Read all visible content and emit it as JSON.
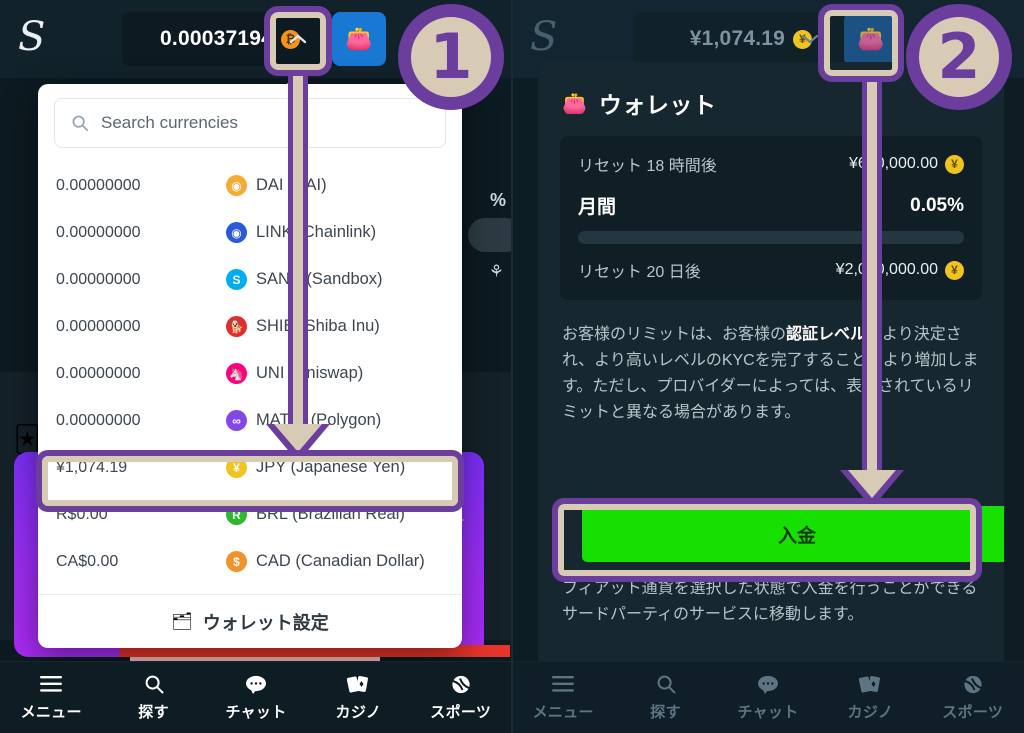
{
  "left": {
    "brand": "S",
    "topbar": {
      "balance_amount": "0.00037194",
      "balance_coin_symbol": "₿",
      "chevron_icon": "chevron-up-icon",
      "wallet_icon": "wallet-icon"
    },
    "background": {
      "percent_text": "%"
    },
    "dropdown": {
      "search_placeholder": "Search currencies",
      "currencies": [
        {
          "amount": "0.00000000",
          "code": "DAI",
          "name": "(DAI)",
          "icon_symbol": "◉",
          "icon_color": "#f5ac37"
        },
        {
          "amount": "0.00000000",
          "code": "LINK",
          "name": "(Chainlink)",
          "icon_symbol": "◉",
          "icon_color": "#2a5ada"
        },
        {
          "amount": "0.00000000",
          "code": "SAND",
          "name": "(Sandbox)",
          "icon_symbol": "S",
          "icon_color": "#00aeef"
        },
        {
          "amount": "0.00000000",
          "code": "SHIB",
          "name": "(Shiba Inu)",
          "icon_symbol": "🐕",
          "icon_color": "#e32c2c"
        },
        {
          "amount": "0.00000000",
          "code": "UNI",
          "name": "(Uniswap)",
          "icon_symbol": "🦄",
          "icon_color": "#ff007a"
        },
        {
          "amount": "0.00000000",
          "code": "MATIC",
          "name": "(Polygon)",
          "icon_symbol": "∞",
          "icon_color": "#8247e5"
        },
        {
          "amount": "¥1,074.19",
          "code": "JPY",
          "name": "(Japanese Yen)",
          "icon_symbol": "¥",
          "icon_color": "#f0c420",
          "selected": true
        },
        {
          "amount": "R$0.00",
          "code": "BRL",
          "name": "(Brazilian Real)",
          "icon_symbol": "R",
          "icon_color": "#2eb82e"
        },
        {
          "amount": "CA$0.00",
          "code": "CAD",
          "name": "(Canadian Dollar)",
          "icon_symbol": "$",
          "icon_color": "#f0932b"
        }
      ],
      "wallet_settings_label": "ウォレット設定",
      "wallet_settings_icon": "wallet-settings-icon"
    },
    "bottom_nav": [
      {
        "label": "メニュー",
        "icon": "menu-icon"
      },
      {
        "label": "探す",
        "icon": "search-icon"
      },
      {
        "label": "チャット",
        "icon": "chat-icon"
      },
      {
        "label": "カジノ",
        "icon": "casino-cards-icon"
      },
      {
        "label": "スポーツ",
        "icon": "sports-ball-icon"
      }
    ]
  },
  "right": {
    "brand": "S",
    "topbar": {
      "balance_amount": "¥1,074.19",
      "balance_coin_symbol": "¥",
      "chevron_icon": "chevron-down-icon",
      "wallet_icon": "wallet-icon"
    },
    "wallet_sheet": {
      "title": "ウォレット",
      "title_icon": "wallet-icon",
      "close_icon": "close-icon",
      "limits": {
        "reset_hours_label": "リセット 18 時間後",
        "reset_hours_value": "¥650,000.00",
        "reset_hours_coin": "¥",
        "monthly_label": "月間",
        "monthly_percent": "0.05%",
        "progress_percent": 0.05,
        "reset_days_label": "リセット 20 日後",
        "reset_days_value": "¥2,000,000.00",
        "reset_days_coin": "¥"
      },
      "note_pre": "お客様のリミットは、お客様の",
      "note_bold": "認証レベル",
      "note_post": "により決定され、より高いレベルのKYCを完了することにより増加します。ただし、プロバイダーによっては、表示されているリミットと異なる場合があります。",
      "deposit_button": "入金",
      "note2": "フィアット通貨を選択した状態で入金を行うことができるサードパーティのサービスに移動します。"
    },
    "bottom_nav": [
      {
        "label": "メニュー",
        "icon": "menu-icon"
      },
      {
        "label": "探す",
        "icon": "search-icon"
      },
      {
        "label": "チャット",
        "icon": "chat-icon"
      },
      {
        "label": "カジノ",
        "icon": "casino-cards-icon"
      },
      {
        "label": "スポーツ",
        "icon": "sports-ball-icon"
      }
    ]
  },
  "annotations": {
    "step1": "1",
    "step2": "2",
    "accent_purple": "#6b3e9e",
    "accent_tan": "#d8cbb6"
  }
}
